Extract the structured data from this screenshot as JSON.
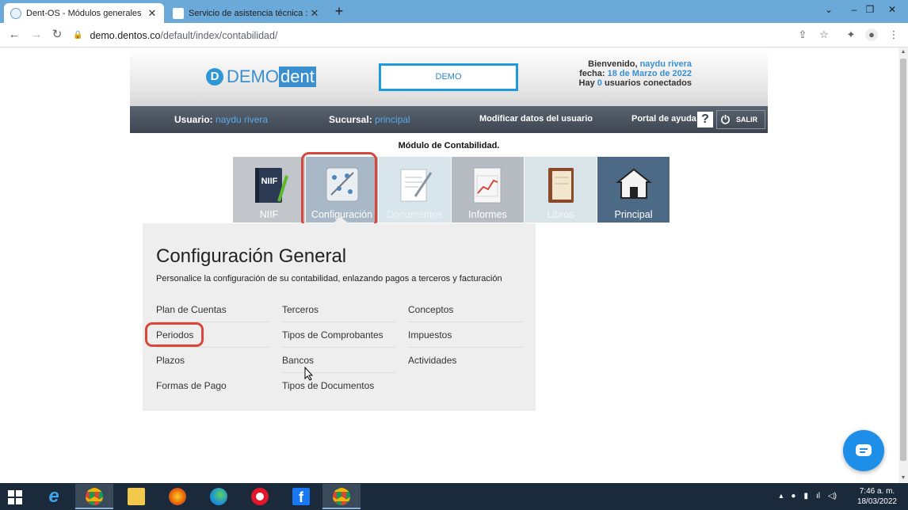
{
  "browser": {
    "tabs": [
      {
        "title": "Dent-OS - Módulos generales",
        "active": true
      },
      {
        "title": "Servicio de asistencia técnica : Sy",
        "active": false
      }
    ],
    "new_tab": "+",
    "url_host": "demo.dentos.co",
    "url_path": "/default/index/contabilidad/"
  },
  "header": {
    "logo_letter": "D",
    "logo_demo": "DEMO",
    "logo_dent": "dent",
    "demo_label": "DEMO",
    "welcome_prefix": "Bienvenido,",
    "welcome_user": "naydu rivera",
    "date_prefix": "fecha:",
    "date_value": "18 de Marzo de 2022",
    "online_prefix": "Hay",
    "online_count": "0",
    "online_suffix": "usuarios conectados"
  },
  "userbar": {
    "usuario_label": "Usuario:",
    "usuario_value": "naydu rivera",
    "sucursal_label": "Sucursal:",
    "sucursal_value": "principal",
    "modificar": "Modificar datos del usuario",
    "portal": "Portal de ayuda",
    "help_glyph": "?",
    "salir": "SALIR"
  },
  "module_title": "Módulo de Contabilidad.",
  "modules": [
    {
      "label": "NIIF",
      "icon": "niif-book-icon"
    },
    {
      "label": "Configuración",
      "icon": "configuration-icon",
      "selected": true
    },
    {
      "label": "Documentos",
      "icon": "documents-icon"
    },
    {
      "label": "Informes",
      "icon": "reports-icon"
    },
    {
      "label": "Libros",
      "icon": "books-icon"
    },
    {
      "label": "Principal",
      "icon": "home-icon"
    }
  ],
  "config": {
    "title": "Configuración General",
    "description": "Personalice la configuración de su contabilidad, enlazando pagos a terceros y facturación",
    "col1": [
      "Plan de Cuentas",
      "Periodos",
      "Plazos",
      "Formas de Pago"
    ],
    "col2": [
      "Terceros",
      "Tipos de Comprobantes",
      "Bancos",
      "Tipos de Documentos"
    ],
    "col3": [
      "Conceptos",
      "Impuestos",
      "Actividades"
    ]
  },
  "taskbar": {
    "time": "7:46 a. m.",
    "date": "18/03/2022"
  },
  "colors": {
    "accent_blue": "#3a8fd0",
    "highlight_red": "#d9463b",
    "userbar_dark": "#3c4550"
  }
}
